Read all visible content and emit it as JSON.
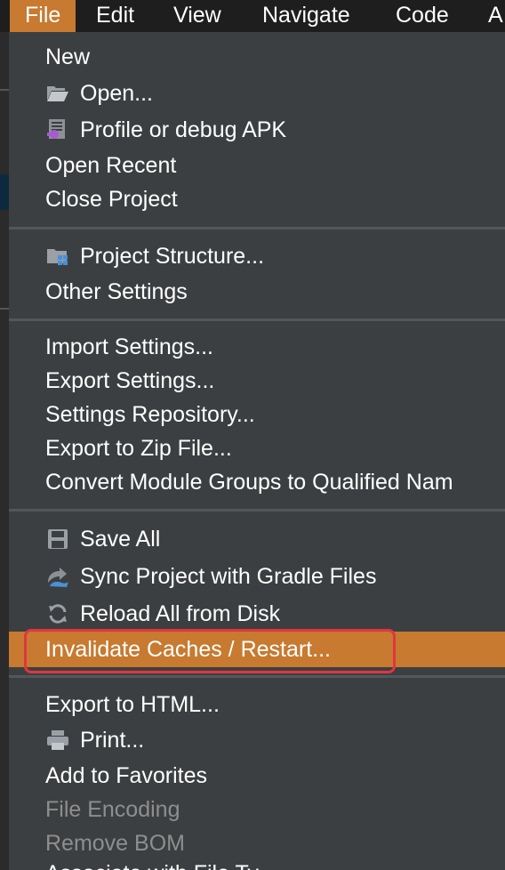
{
  "menubar": {
    "items": [
      "File",
      "Edit",
      "View",
      "Navigate",
      "Code",
      "A"
    ],
    "active_index": 0
  },
  "colors": {
    "menubar_bg": "#1e1e1e",
    "menu_bg": "#3c3f41",
    "highlight": "#c77a30",
    "separator": "#545759",
    "disabled_text": "#8e8e8e",
    "annotation_border": "#e0363f"
  },
  "file_menu": {
    "groups": [
      {
        "items": [
          {
            "label": "New",
            "icon": null,
            "enabled": true
          },
          {
            "label": "Open...",
            "icon": "folder-icon",
            "enabled": true
          },
          {
            "label": "Profile or debug APK",
            "icon": "apk-icon",
            "enabled": true
          },
          {
            "label": "Open Recent",
            "icon": null,
            "enabled": true
          },
          {
            "label": "Close Project",
            "icon": null,
            "enabled": true
          }
        ]
      },
      {
        "items": [
          {
            "label": "Project Structure...",
            "icon": "project-structure-icon",
            "enabled": true
          },
          {
            "label": "Other Settings",
            "icon": null,
            "enabled": true
          }
        ]
      },
      {
        "items": [
          {
            "label": "Import Settings...",
            "icon": null,
            "enabled": true
          },
          {
            "label": "Export Settings...",
            "icon": null,
            "enabled": true
          },
          {
            "label": "Settings Repository...",
            "icon": null,
            "enabled": true
          },
          {
            "label": "Export to Zip File...",
            "icon": null,
            "enabled": true
          },
          {
            "label": "Convert Module Groups to Qualified Nam",
            "icon": null,
            "enabled": true
          }
        ]
      },
      {
        "items": [
          {
            "label": "Save All",
            "icon": "save-icon",
            "enabled": true
          },
          {
            "label": "Sync Project with Gradle Files",
            "icon": "gradle-sync-icon",
            "enabled": true
          },
          {
            "label": "Reload All from Disk",
            "icon": "reload-icon",
            "enabled": true
          },
          {
            "label": "Invalidate Caches / Restart...",
            "icon": null,
            "enabled": true,
            "highlighted": true
          }
        ]
      },
      {
        "items": [
          {
            "label": "Export to HTML...",
            "icon": null,
            "enabled": true
          },
          {
            "label": "Print...",
            "icon": "printer-icon",
            "enabled": true
          },
          {
            "label": "Add to Favorites",
            "icon": null,
            "enabled": true
          },
          {
            "label": "File Encoding",
            "icon": null,
            "enabled": false
          },
          {
            "label": "Remove BOM",
            "icon": null,
            "enabled": false
          },
          {
            "label": "Associate with File Ty",
            "icon": null,
            "enabled": true
          }
        ]
      }
    ]
  }
}
